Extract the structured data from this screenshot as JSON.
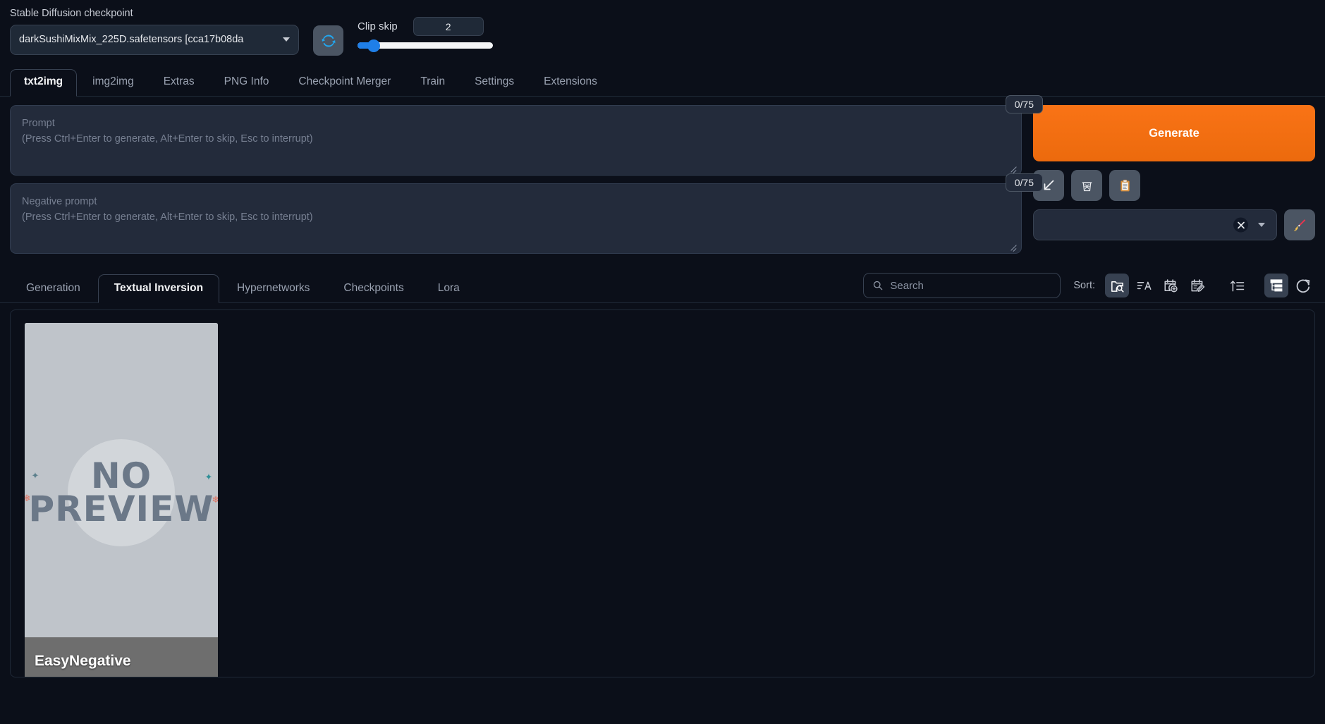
{
  "topbar": {
    "checkpoint_label": "Stable Diffusion checkpoint",
    "checkpoint_value": "darkSushiMixMix_225D.safetensors [cca17b08da",
    "refresh_icon": "refresh-icon",
    "clip_skip_label": "Clip skip",
    "clip_skip_value": "2",
    "clip_skip_percent": 12
  },
  "main_tabs": [
    {
      "label": "txt2img",
      "active": true
    },
    {
      "label": "img2img",
      "active": false
    },
    {
      "label": "Extras",
      "active": false
    },
    {
      "label": "PNG Info",
      "active": false
    },
    {
      "label": "Checkpoint Merger",
      "active": false
    },
    {
      "label": "Train",
      "active": false
    },
    {
      "label": "Settings",
      "active": false
    },
    {
      "label": "Extensions",
      "active": false
    }
  ],
  "prompt": {
    "placeholder_title": "Prompt",
    "placeholder_hint": "(Press Ctrl+Enter to generate, Alt+Enter to skip, Esc to interrupt)",
    "value": "",
    "token_count": "0/75"
  },
  "negative_prompt": {
    "placeholder_title": "Negative prompt",
    "placeholder_hint": "(Press Ctrl+Enter to generate, Alt+Enter to skip, Esc to interrupt)",
    "value": "",
    "token_count": "0/75"
  },
  "actions": {
    "generate_label": "Generate",
    "generate_color": "#f97316",
    "buttons": [
      {
        "name": "interrogate-arrow",
        "glyph": "↙"
      },
      {
        "name": "clear-prompt-trash",
        "glyph": "🗑"
      },
      {
        "name": "restore-progress-clipboard",
        "glyph": "📋"
      }
    ],
    "styles_value": "",
    "styles_clear_glyph": "✕",
    "brush_icon": "paintbrush-icon"
  },
  "extra_networks": {
    "tabs": [
      {
        "label": "Generation",
        "active": false
      },
      {
        "label": "Textual Inversion",
        "active": true
      },
      {
        "label": "Hypernetworks",
        "active": false
      },
      {
        "label": "Checkpoints",
        "active": false
      },
      {
        "label": "Lora",
        "active": false
      }
    ],
    "search_placeholder": "Search",
    "search_value": "",
    "sort_label": "Sort:",
    "sort_buttons": [
      {
        "name": "sort-by-path-icon",
        "active": true
      },
      {
        "name": "sort-by-name-icon",
        "active": false
      },
      {
        "name": "sort-by-date-created-icon",
        "active": false
      },
      {
        "name": "sort-by-date-modified-icon",
        "active": false
      },
      {
        "name": "sort-order-ascending-icon",
        "active": false
      },
      {
        "name": "tree-view-icon",
        "active": true
      },
      {
        "name": "refresh-networks-icon",
        "active": false
      }
    ],
    "cards": [
      {
        "title": "EasyNegative",
        "preview_line1": "NO",
        "preview_line2": "PREVIEW",
        "has_preview": false
      }
    ]
  }
}
